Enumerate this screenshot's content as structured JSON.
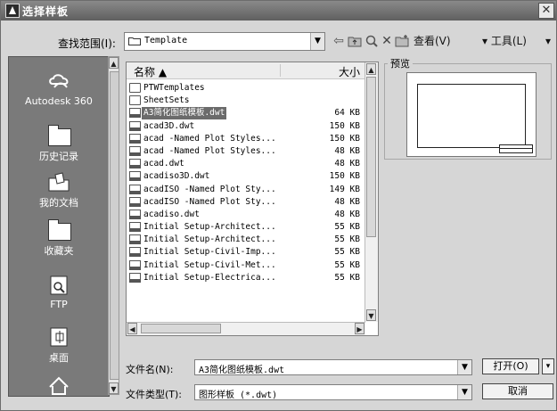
{
  "window": {
    "title": "选择样板",
    "close_glyph": "✕"
  },
  "toolbar": {
    "lookin_label": "查找范围(I):",
    "lookin_value": "Template",
    "views_label": "查看(V)",
    "tools_label": "▾ 工具(L)",
    "overflow": "▾"
  },
  "places": [
    {
      "label": "Autodesk 360",
      "icon": "cloud-icon"
    },
    {
      "label": "历史记录",
      "icon": "folder-icon"
    },
    {
      "label": "我的文档",
      "icon": "documents-icon"
    },
    {
      "label": "收藏夹",
      "icon": "folder-icon"
    },
    {
      "label": "FTP",
      "icon": "ftp-icon"
    },
    {
      "label": "桌面",
      "icon": "desktop-icon"
    }
  ],
  "list": {
    "header_name": "名称 ▲",
    "header_size": "大小",
    "rows": [
      {
        "name": "PTWTemplates",
        "size": "",
        "type": "folder"
      },
      {
        "name": "SheetSets",
        "size": "",
        "type": "folder"
      },
      {
        "name": "A3简化图纸模板.dwt",
        "size": "64 KB",
        "type": "dwt",
        "selected": true
      },
      {
        "name": "acad3D.dwt",
        "size": "150 KB",
        "type": "dwt"
      },
      {
        "name": "acad -Named Plot Styles...",
        "size": "150 KB",
        "type": "dwt"
      },
      {
        "name": "acad -Named Plot Styles...",
        "size": "48 KB",
        "type": "dwt"
      },
      {
        "name": "acad.dwt",
        "size": "48 KB",
        "type": "dwt"
      },
      {
        "name": "acadiso3D.dwt",
        "size": "150 KB",
        "type": "dwt"
      },
      {
        "name": "acadISO -Named Plot Sty...",
        "size": "149 KB",
        "type": "dwt"
      },
      {
        "name": "acadISO -Named Plot Sty...",
        "size": "48 KB",
        "type": "dwt"
      },
      {
        "name": "acadiso.dwt",
        "size": "48 KB",
        "type": "dwt"
      },
      {
        "name": "Initial Setup-Architect...",
        "size": "55 KB",
        "type": "dwt"
      },
      {
        "name": "Initial Setup-Architect...",
        "size": "55 KB",
        "type": "dwt"
      },
      {
        "name": "Initial Setup-Civil-Imp...",
        "size": "55 KB",
        "type": "dwt"
      },
      {
        "name": "Initial Setup-Civil-Met...",
        "size": "55 KB",
        "type": "dwt"
      },
      {
        "name": "Initial Setup-Electrica...",
        "size": "55 KB",
        "type": "dwt"
      }
    ]
  },
  "preview": {
    "label": "预览"
  },
  "filename": {
    "label": "文件名(N):",
    "value": "A3简化图纸模板.dwt"
  },
  "filetype": {
    "label": "文件类型(T):",
    "value": "图形样板 (*.dwt)"
  },
  "buttons": {
    "open": "打开(O)",
    "cancel": "取消",
    "open_menu": "▾"
  }
}
